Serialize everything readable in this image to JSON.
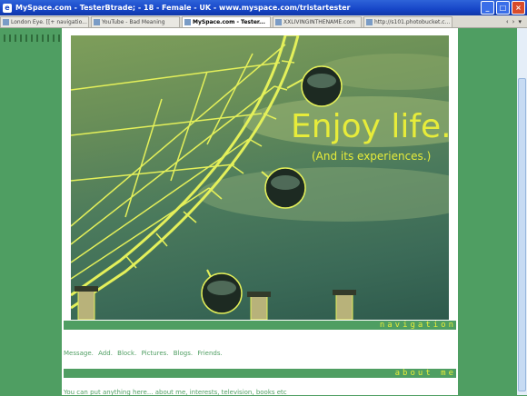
{
  "window": {
    "title": "MySpace.com - TesterBtrade; - 18 - Female - UK - www.myspace.com/tristartester",
    "buttons": {
      "minimize": "_",
      "maximize": "□",
      "close": "×"
    }
  },
  "tabs": [
    {
      "label": "London Eye. [[+ navigatio...",
      "active": false
    },
    {
      "label": "YouTube - Bad Meaning",
      "active": false
    },
    {
      "label": "MySpace.com - Tester...",
      "active": true
    },
    {
      "label": "XXLIVINGINTHENAME.com",
      "active": false
    },
    {
      "label": "http://s101.photobucket.c...",
      "active": false
    }
  ],
  "tab_nav": {
    "prev": "‹",
    "next": "›",
    "menu": "▾"
  },
  "hero": {
    "headline": "Enjoy life.",
    "subline": "(And its experiences.)",
    "accent_color": "#e7ec3a"
  },
  "navigation": {
    "heading": "navigation",
    "links": [
      "Message.",
      "Add.",
      "Block.",
      "Pictures.",
      "Blogs.",
      "Friends."
    ]
  },
  "about": {
    "heading": "about me",
    "text": "You can put anything here... about me, interests, television, books etc"
  },
  "colors": {
    "page_bg": "#4f9e62",
    "titlebar": "#1746c8"
  }
}
